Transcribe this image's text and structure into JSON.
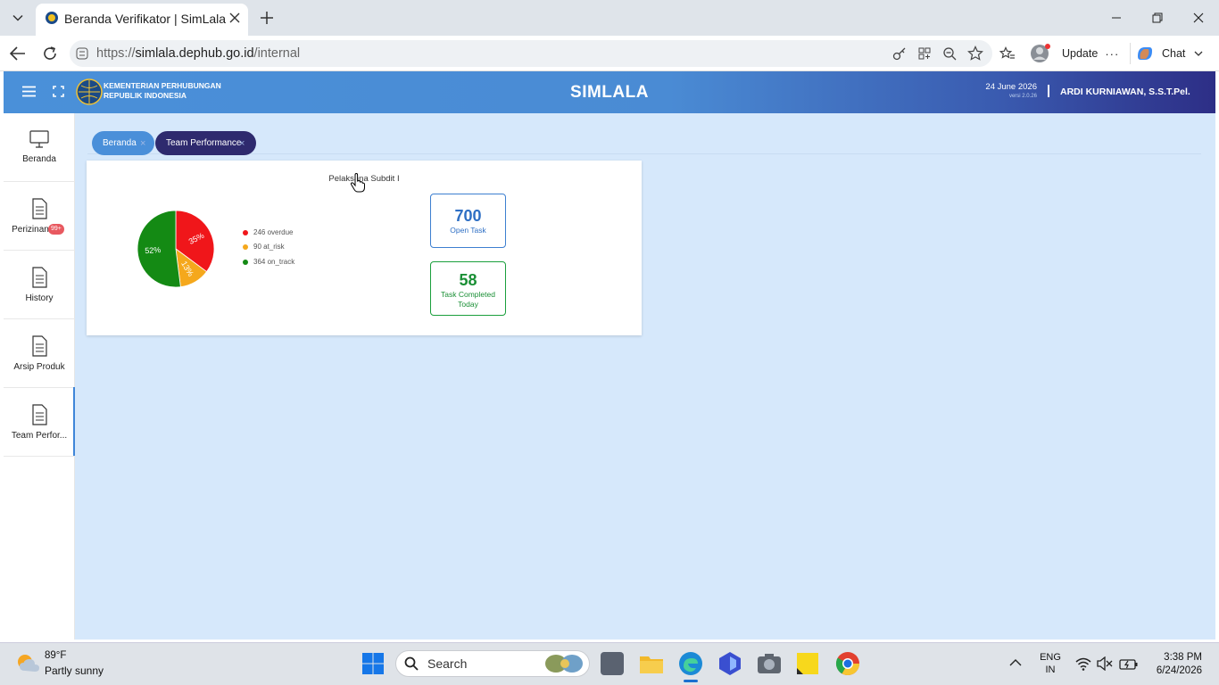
{
  "browser": {
    "tab_title": "Beranda Verifikator | SimLala",
    "url_prefix": "https://",
    "url_host": "simlala.dephub.go.id",
    "url_path": "/internal",
    "update_label": "Update",
    "chat_label": "Chat"
  },
  "header": {
    "ministry_line1": "KEMENTERIAN PERHUBUNGAN",
    "ministry_line2": "REPUBLIK INDONESIA",
    "app_title": "SIMLALA",
    "date": "24 June 2026",
    "version": "versi 2.0.26",
    "user": "ARDI KURNIAWAN, S.S.T.Pel."
  },
  "sidebar": {
    "items": [
      {
        "label": "Beranda",
        "icon": "monitor-icon"
      },
      {
        "label": "Perizinan",
        "icon": "document-icon",
        "badge": "99+"
      },
      {
        "label": "History",
        "icon": "document-icon"
      },
      {
        "label": "Arsip Produk",
        "icon": "document-icon"
      },
      {
        "label": "Team Perfor...",
        "icon": "document-icon",
        "active": true
      }
    ]
  },
  "tabs": [
    {
      "label": "Beranda"
    },
    {
      "label": "Team Performance",
      "active": true
    }
  ],
  "card": {
    "title": "Pelaksana Subdit I",
    "open_task": {
      "value": "700",
      "label": "Open Task"
    },
    "completed": {
      "value": "58",
      "label_line1": "Task Completed",
      "label_line2": "Today"
    }
  },
  "chart_data": {
    "type": "pie",
    "categories": [
      "overdue",
      "at_risk",
      "on_track"
    ],
    "values": [
      246,
      90,
      364
    ],
    "legend": [
      "246 overdue",
      "90 at_risk",
      "364 on_track"
    ],
    "slice_labels": [
      "35%",
      "13%",
      "52%"
    ],
    "colors": [
      "#f0161a",
      "#f5a81c",
      "#148a14"
    ],
    "legend_position": "right"
  },
  "taskbar": {
    "weather_temp": "89°F",
    "weather_desc": "Partly sunny",
    "search_placeholder": "Search",
    "lang_line1": "ENG",
    "lang_line2": "IN",
    "time": "3:38 PM",
    "date": "6/24/2026"
  }
}
